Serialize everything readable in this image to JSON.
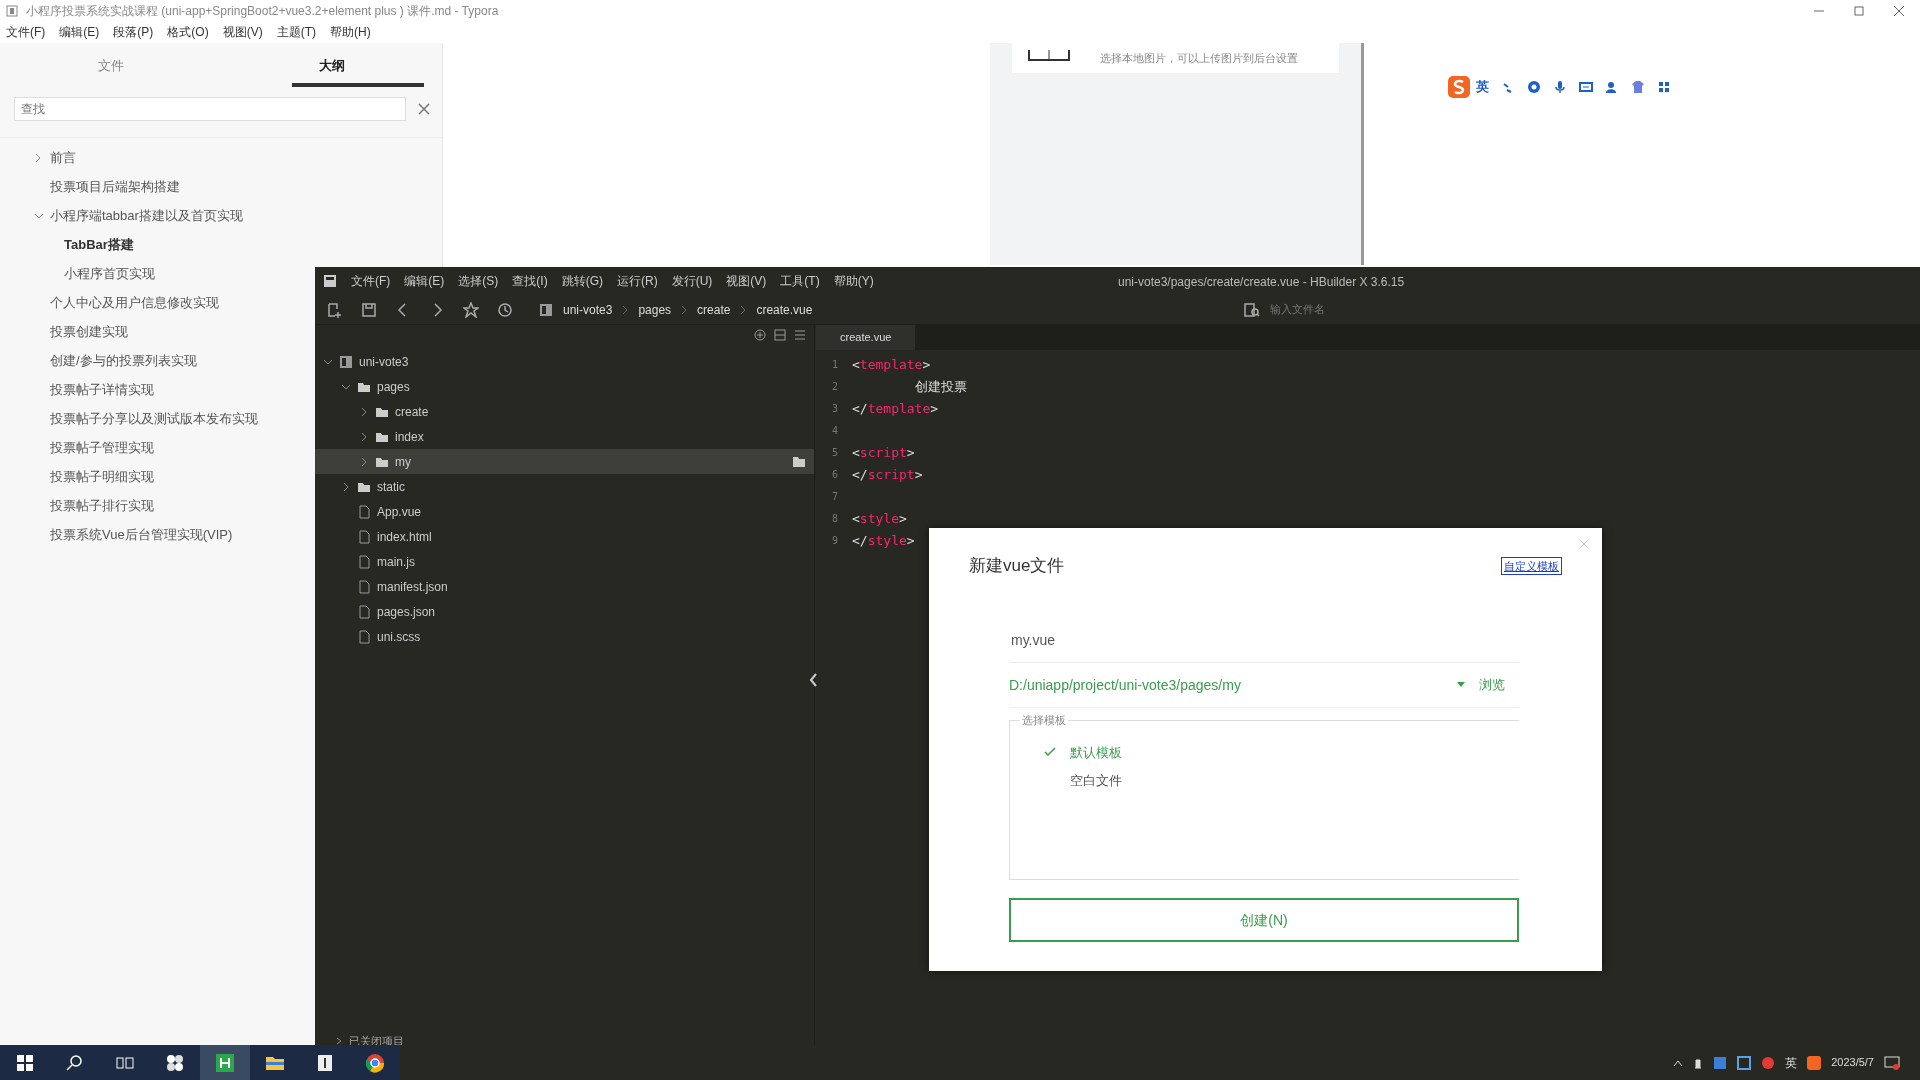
{
  "typora": {
    "title": "小程序投票系统实战课程 (uni-app+SpringBoot2+vue3.2+element plus ) 课件.md - Typora",
    "menu": [
      "文件(F)",
      "编辑(E)",
      "段落(P)",
      "格式(O)",
      "视图(V)",
      "主题(T)",
      "帮助(H)"
    ],
    "sidebar_tabs": [
      {
        "label": "文件",
        "selected": false
      },
      {
        "label": "大纲",
        "selected": true
      }
    ],
    "filter": {
      "placeholder": "查找"
    },
    "outline": [
      {
        "text": "前言",
        "kind": "collapsed",
        "current": false
      },
      {
        "text": "投票项目后端架构搭建",
        "kind": "leaf",
        "current": false
      },
      {
        "text": "小程序端tabbar搭建以及首页实现",
        "kind": "expanded",
        "current": false,
        "children": [
          {
            "text": "TabBar搭建",
            "kind": "leaf",
            "current": true
          },
          {
            "text": "小程序首页实现",
            "kind": "leaf",
            "current": false
          }
        ]
      },
      {
        "text": "个人中心及用户信息修改实现",
        "kind": "leaf",
        "current": false
      },
      {
        "text": "投票创建实现",
        "kind": "leaf",
        "current": false
      },
      {
        "text": "创建/参与的投票列表实现",
        "kind": "leaf",
        "current": false
      },
      {
        "text": "投票帖子详情实现",
        "kind": "leaf",
        "current": false
      },
      {
        "text": "投票帖子分享以及测试版本发布实现",
        "kind": "leaf",
        "current": false
      },
      {
        "text": "投票帖子管理实现",
        "kind": "leaf",
        "current": false
      },
      {
        "text": "投票帖子明细实现",
        "kind": "leaf",
        "current": false
      },
      {
        "text": "投票帖子排行实现",
        "kind": "leaf",
        "current": false
      },
      {
        "text": "投票系统Vue后台管理实现(VIP)",
        "kind": "leaf",
        "current": false
      }
    ],
    "document_card": {
      "text": "选择本地图片，可以上传图片到后台设置"
    },
    "ime_toolbar": {
      "mode": "英"
    }
  },
  "hbuilder": {
    "title": "uni-vote3/pages/create/create.vue - HBuilder X 3.6.15",
    "menu": [
      "文件(F)",
      "编辑(E)",
      "选择(S)",
      "查找(I)",
      "跳转(G)",
      "运行(R)",
      "发行(U)",
      "视图(V)",
      "工具(T)",
      "帮助(Y)"
    ],
    "breadcrumb": [
      "uni-vote3",
      "pages",
      "create",
      "create.vue"
    ],
    "file_search": {
      "placeholder": "输入文件名"
    },
    "tree": [
      {
        "name": "uni-vote3",
        "kind": "project",
        "expanded": true,
        "selected": false,
        "children": [
          {
            "name": "pages",
            "kind": "folder",
            "expanded": true,
            "selected": false,
            "children": [
              {
                "name": "create",
                "kind": "folder",
                "expanded": false,
                "selected": false
              },
              {
                "name": "index",
                "kind": "folder",
                "expanded": false,
                "selected": false
              },
              {
                "name": "my",
                "kind": "folder",
                "expanded": false,
                "selected": true
              }
            ]
          },
          {
            "name": "static",
            "kind": "folder",
            "expanded": false,
            "selected": false
          },
          {
            "name": "App.vue",
            "kind": "file",
            "selected": false
          },
          {
            "name": "index.html",
            "kind": "file",
            "selected": false
          },
          {
            "name": "main.js",
            "kind": "file",
            "selected": false
          },
          {
            "name": "manifest.json",
            "kind": "file",
            "selected": false
          },
          {
            "name": "pages.json",
            "kind": "file",
            "selected": false
          },
          {
            "name": "uni.scss",
            "kind": "file",
            "selected": false
          }
        ]
      }
    ],
    "bottom_label": "已关闭项目",
    "tab": {
      "label": "create.vue"
    },
    "code": [
      {
        "number": "1",
        "text": "<template>"
      },
      {
        "number": "2",
        "text": "\t创建投票"
      },
      {
        "number": "3",
        "text": "</template>"
      },
      {
        "number": "4"
      },
      {
        "number": "5",
        "text": "<script>"
      },
      {
        "number": "6",
        "text": "</script>"
      },
      {
        "number": "7"
      },
      {
        "number": "8",
        "text": "<style>"
      },
      {
        "number": "9",
        "text": "</style>"
      }
    ]
  },
  "dialog": {
    "title": "新建vue文件",
    "template_link": "自定义模板",
    "name_field": {
      "value": "my.vue"
    },
    "path_field": {
      "value": "D:/uniapp/project/uni-vote3/pages/my"
    },
    "browse": "浏览",
    "template_group": {
      "legend": "选择模板",
      "options": [
        {
          "label": "默认模板",
          "selected": true
        },
        {
          "label": "空白文件",
          "selected": false
        }
      ]
    },
    "create_button": "创建(N)"
  },
  "taskbar": {
    "apps": [
      {
        "kind": "start",
        "active": false
      },
      {
        "kind": "search",
        "active": false
      },
      {
        "kind": "taskview",
        "active": false
      },
      {
        "kind": "pinwheel",
        "active": false
      },
      {
        "kind": "hbuilder",
        "active": true
      },
      {
        "kind": "explorer",
        "active": false
      },
      {
        "kind": "typora",
        "active": false
      },
      {
        "kind": "chrome",
        "active": false
      }
    ],
    "tray": {
      "ime": "英",
      "date": "2023/5/7"
    }
  }
}
